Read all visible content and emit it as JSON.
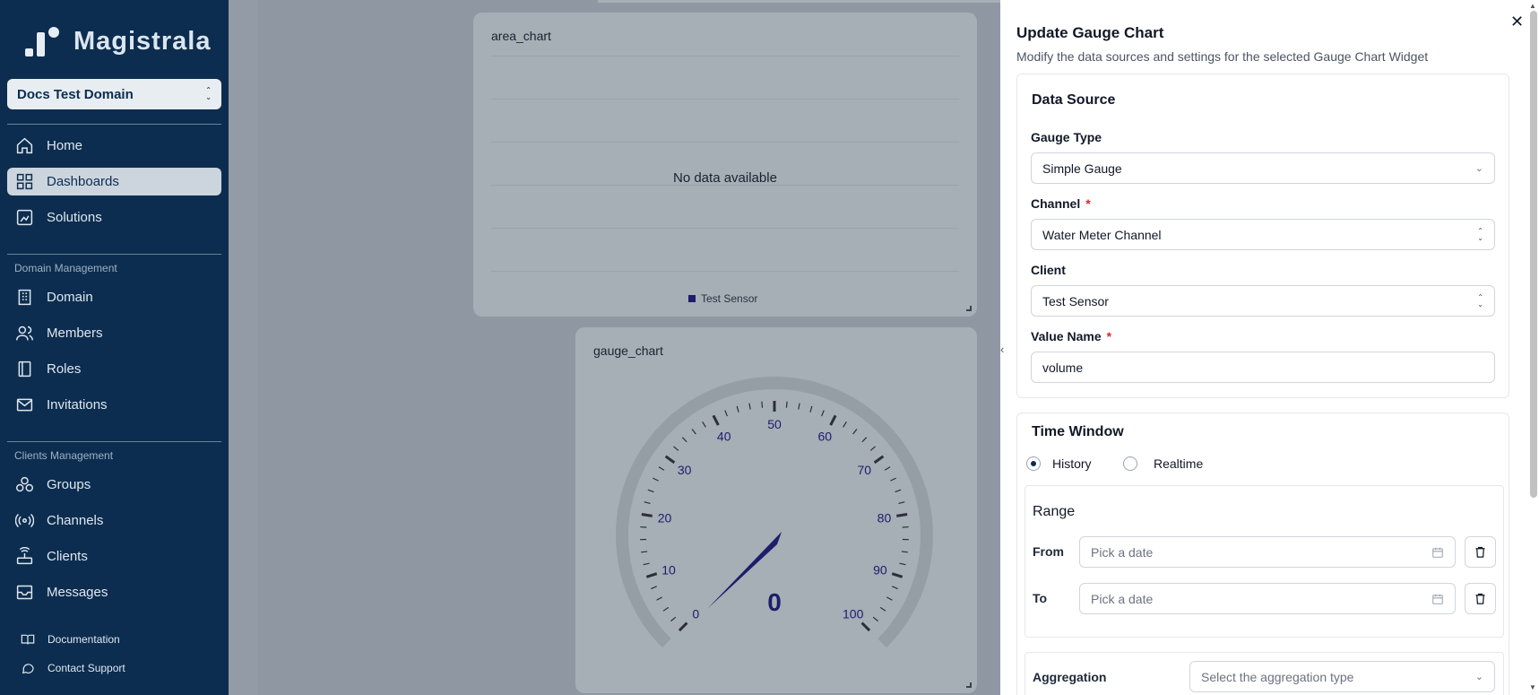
{
  "brand": {
    "name": "Magistrala"
  },
  "domain_select": {
    "value": "Docs Test Domain"
  },
  "sidebar": {
    "main_items": [
      {
        "label": "Home",
        "icon": "home-icon",
        "active": false
      },
      {
        "label": "Dashboards",
        "icon": "dashboard-icon",
        "active": true
      },
      {
        "label": "Solutions",
        "icon": "solutions-icon",
        "active": false
      }
    ],
    "domain_section": "Domain Management",
    "domain_items": [
      {
        "label": "Domain",
        "icon": "building-icon"
      },
      {
        "label": "Members",
        "icon": "users-icon"
      },
      {
        "label": "Roles",
        "icon": "book-icon"
      },
      {
        "label": "Invitations",
        "icon": "mail-icon"
      }
    ],
    "clients_section": "Clients Management",
    "clients_items": [
      {
        "label": "Groups",
        "icon": "groups-icon"
      },
      {
        "label": "Channels",
        "icon": "radio-icon"
      },
      {
        "label": "Clients",
        "icon": "router-icon"
      },
      {
        "label": "Messages",
        "icon": "messages-icon"
      }
    ],
    "footer": [
      {
        "label": "Documentation",
        "icon": "book-open-icon"
      },
      {
        "label": "Contact Support",
        "icon": "chat-icon"
      }
    ]
  },
  "area_card": {
    "title": "area_chart",
    "empty_text": "No data available",
    "legend": "Test Sensor"
  },
  "gauge_card": {
    "title": "gauge_chart"
  },
  "chart_data": {
    "type": "gauge",
    "min": 0,
    "max": 100,
    "value": 0,
    "value_label": "0",
    "ticks": [
      "0",
      "10",
      "20",
      "30",
      "40",
      "50",
      "60",
      "70",
      "80",
      "90",
      "100"
    ]
  },
  "panel": {
    "title": "Update Gauge Chart",
    "subtitle": "Modify the data sources and settings for the selected Gauge Chart Widget",
    "data_source": {
      "title": "Data Source",
      "gauge_type_label": "Gauge Type",
      "gauge_type_value": "Simple Gauge",
      "channel_label": "Channel",
      "channel_value": "Water Meter Channel",
      "client_label": "Client",
      "client_value": "Test Sensor",
      "value_name_label": "Value Name",
      "value_name_value": "volume",
      "required_mark": "*"
    },
    "time_window": {
      "title": "Time Window",
      "history_label": "History",
      "realtime_label": "Realtime",
      "selected": "History",
      "range_title": "Range",
      "from_label": "From",
      "to_label": "To",
      "date_placeholder": "Pick a date"
    },
    "aggregation": {
      "label": "Aggregation",
      "placeholder": "Select the aggregation type"
    }
  },
  "colors": {
    "sidebar_bg": "#0c2d4f",
    "gauge_navy": "#1d1d6b",
    "required": "#dc2626"
  }
}
